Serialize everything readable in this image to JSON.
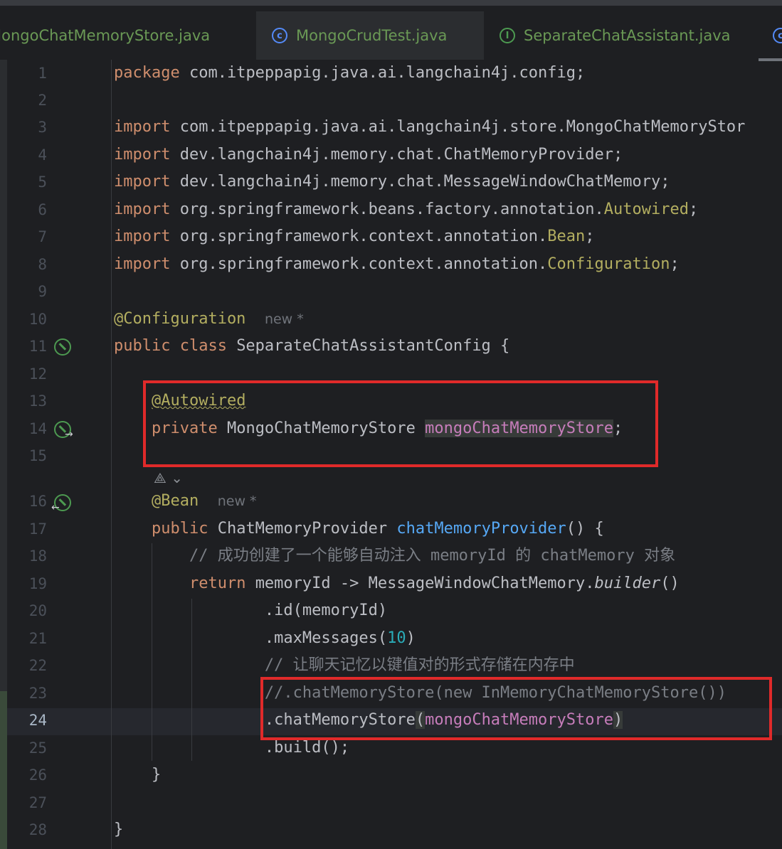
{
  "tabs": [
    {
      "label": "MongoChatMemoryStore.java",
      "icon": "class-icon",
      "active": false
    },
    {
      "label": "MongoCrudTest.java",
      "icon": "test-class-icon",
      "active": true
    },
    {
      "label": "SeparateChatAssistant.java",
      "icon": "interface-icon",
      "active": false
    }
  ],
  "editor": {
    "current_line": 24,
    "inlay_hint": "new *",
    "lines": [
      {
        "n": "1",
        "parts": [
          [
            "kw",
            "package "
          ],
          [
            "",
            "com.itpeppapig.java.ai.langchain4j.config;"
          ]
        ]
      },
      {
        "n": "2",
        "parts": []
      },
      {
        "n": "3",
        "parts": [
          [
            "kw",
            "import "
          ],
          [
            "",
            "com.itpeppapig.java.ai.langchain4j.store.MongoChatMemoryStor"
          ]
        ]
      },
      {
        "n": "4",
        "parts": [
          [
            "kw",
            "import "
          ],
          [
            "",
            "dev.langchain4j.memory.chat.ChatMemoryProvider;"
          ]
        ]
      },
      {
        "n": "5",
        "parts": [
          [
            "kw",
            "import "
          ],
          [
            "",
            "dev.langchain4j.memory.chat.MessageWindowChatMemory;"
          ]
        ]
      },
      {
        "n": "6",
        "parts": [
          [
            "kw",
            "import "
          ],
          [
            "",
            "org.springframework.beans.factory.annotation."
          ],
          [
            "ann",
            "Autowired"
          ],
          [
            "",
            ";"
          ]
        ]
      },
      {
        "n": "7",
        "parts": [
          [
            "kw",
            "import "
          ],
          [
            "",
            "org.springframework.context.annotation."
          ],
          [
            "ann",
            "Bean"
          ],
          [
            "",
            ";"
          ]
        ]
      },
      {
        "n": "8",
        "parts": [
          [
            "kw",
            "import "
          ],
          [
            "",
            "org.springframework.context.annotation."
          ],
          [
            "ann",
            "Configuration"
          ],
          [
            "",
            ";"
          ]
        ]
      },
      {
        "n": "9",
        "parts": []
      },
      {
        "n": "10",
        "parts": [
          [
            "ann",
            "@Configuration"
          ],
          [
            "",
            "  "
          ],
          [
            "hint",
            "new *"
          ]
        ]
      },
      {
        "n": "11",
        "parts": [
          [
            "kw",
            "public class "
          ],
          [
            "",
            "SeparateChatAssistantConfig {"
          ]
        ]
      },
      {
        "n": "12",
        "parts": []
      },
      {
        "n": "13",
        "parts": [
          [
            "",
            "    "
          ],
          [
            "ann squig",
            "@Autowired"
          ]
        ]
      },
      {
        "n": "14",
        "parts": [
          [
            "",
            "    "
          ],
          [
            "kw",
            "private "
          ],
          [
            "",
            "MongoChatMemoryStore "
          ],
          [
            "fld hl",
            "mongoChatMemoryStore"
          ],
          [
            "",
            ";"
          ]
        ]
      },
      {
        "n": "15",
        "parts": []
      },
      {
        "n": "16",
        "parts": [
          [
            "",
            "    "
          ],
          [
            "ann",
            "@Bean"
          ],
          [
            "",
            "  "
          ],
          [
            "hint",
            "new *"
          ]
        ]
      },
      {
        "n": "17",
        "parts": [
          [
            "",
            "    "
          ],
          [
            "kw",
            "public "
          ],
          [
            "",
            "ChatMemoryProvider "
          ],
          [
            "fn",
            "chatMemoryProvider"
          ],
          [
            "",
            "() {"
          ]
        ]
      },
      {
        "n": "18",
        "parts": [
          [
            "",
            "        "
          ],
          [
            "cmt",
            "// 成功创建了一个能够自动注入 memoryId 的 chatMemory 对象"
          ]
        ]
      },
      {
        "n": "19",
        "parts": [
          [
            "",
            "        "
          ],
          [
            "kw",
            "return "
          ],
          [
            "",
            "memoryId -> MessageWindowChatMemory."
          ],
          [
            "it",
            "builder"
          ],
          [
            "",
            "()"
          ]
        ]
      },
      {
        "n": "20",
        "parts": [
          [
            "",
            "                ",
            ""
          ],
          [
            "",
            ".id(memoryId)"
          ]
        ]
      },
      {
        "n": "21",
        "parts": [
          [
            "",
            "                "
          ],
          [
            "",
            ".maxMessages("
          ],
          [
            "num",
            "10"
          ],
          [
            "",
            ")"
          ]
        ]
      },
      {
        "n": "22",
        "parts": [
          [
            "",
            "                "
          ],
          [
            "cmt",
            "// 让聊天记忆以键值对的形式存储在内存中"
          ]
        ]
      },
      {
        "n": "23",
        "parts": [
          [
            "",
            "                "
          ],
          [
            "cmt",
            "//.chatMemoryStore(new InMemoryChatMemoryStore())"
          ]
        ]
      },
      {
        "n": "24",
        "parts": [
          [
            "",
            "                "
          ],
          [
            "",
            ".chatMemoryStore"
          ],
          [
            "hl",
            "("
          ],
          [
            "fld",
            "mongoChatMemoryStore"
          ],
          [
            "hl",
            ")"
          ]
        ]
      },
      {
        "n": "25",
        "parts": [
          [
            "",
            "                "
          ],
          [
            "",
            ".build();"
          ]
        ]
      },
      {
        "n": "26",
        "parts": [
          [
            "",
            "    }"
          ]
        ]
      },
      {
        "n": "27",
        "parts": []
      },
      {
        "n": "28",
        "parts": [
          [
            "",
            "}"
          ]
        ]
      }
    ]
  },
  "gutter_icons": [
    {
      "line": "11",
      "name": "bean-config-icon"
    },
    {
      "line": "14",
      "name": "navigate-to-bean-icon"
    },
    {
      "line": "16",
      "name": "bean-provider-icon"
    }
  ],
  "colors": {
    "background": "#1e1f22",
    "keyword": "#cf8e6d",
    "annotation": "#b3ae60",
    "field": "#c77dbb",
    "method": "#56a8f5",
    "number": "#2aacb8",
    "comment": "#7a7e85",
    "highlight_box": "#e02a2a"
  }
}
